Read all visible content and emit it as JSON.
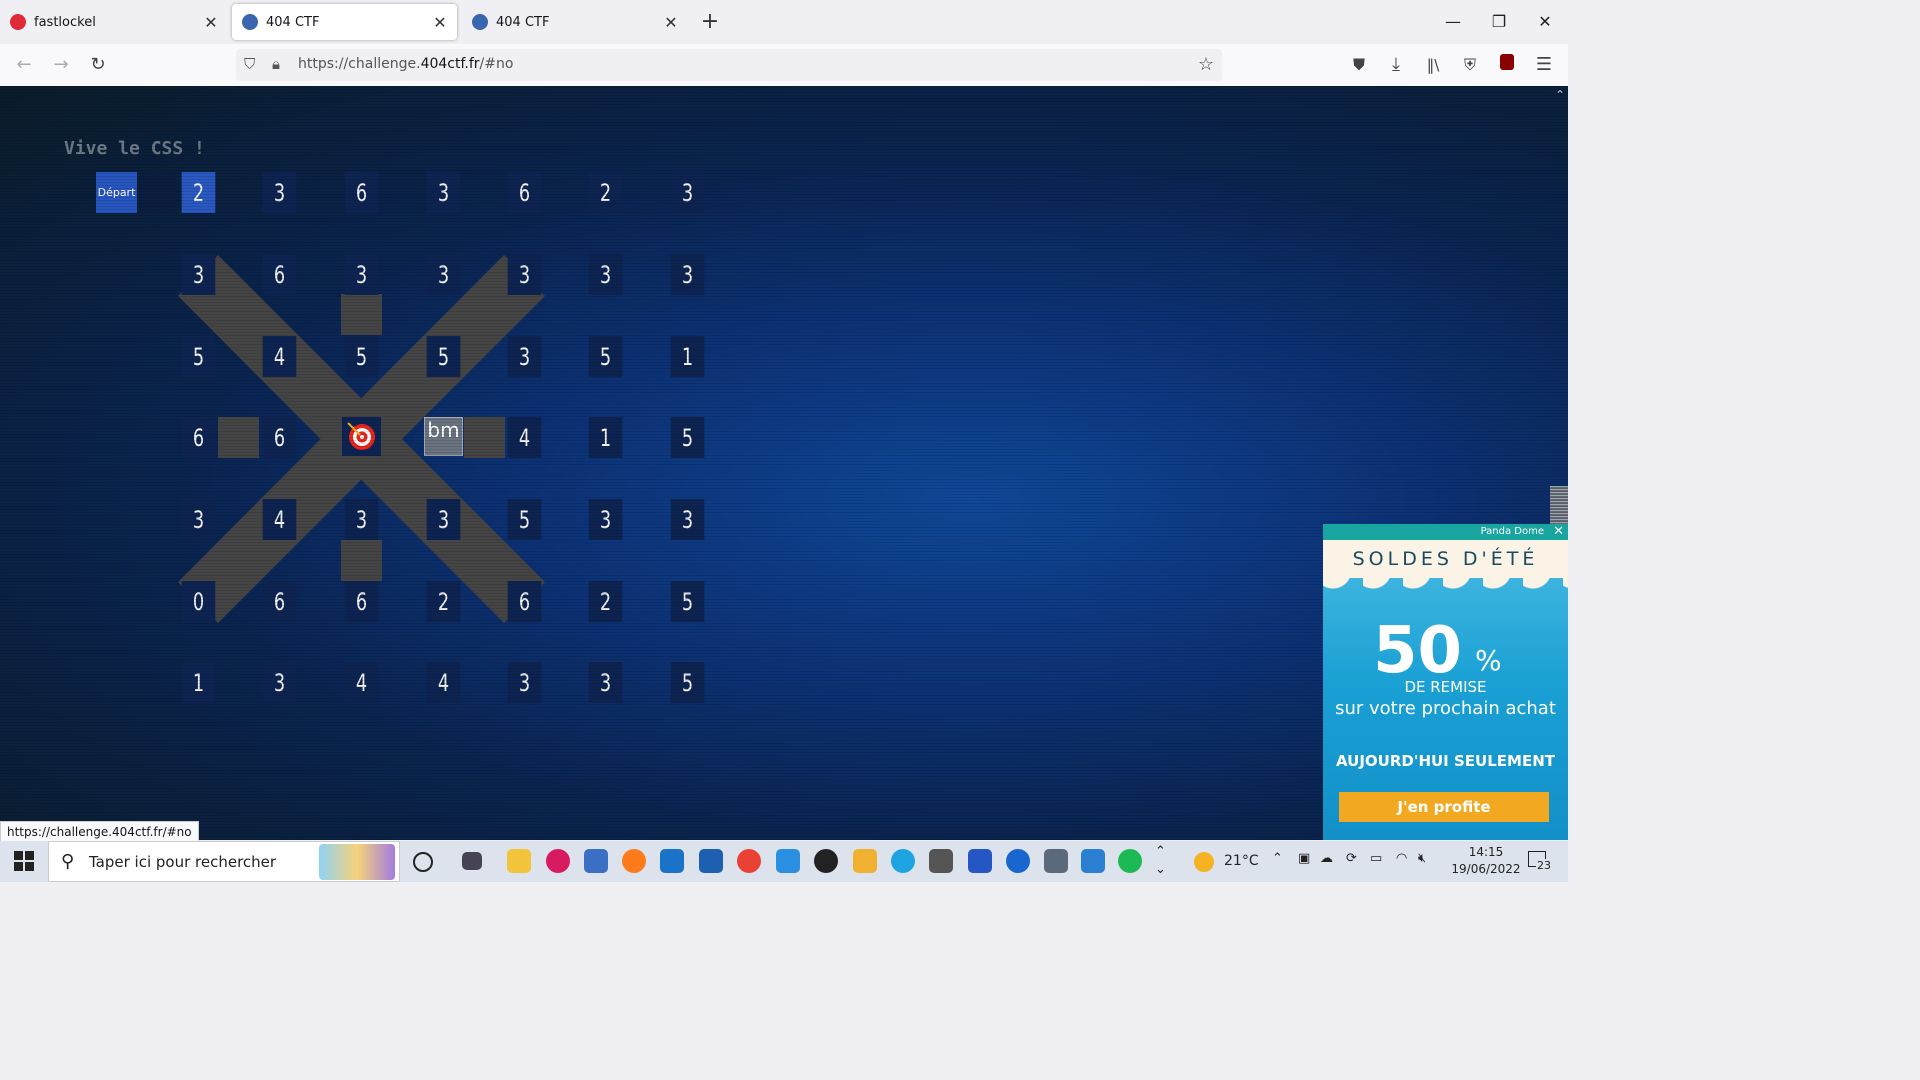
{
  "browser": {
    "tabs": [
      {
        "title": "fastlockel",
        "favicon_color": "#e02a3a"
      },
      {
        "title": "404 CTF",
        "favicon_color": "#3a66b0",
        "active": true
      },
      {
        "title": "404 CTF",
        "favicon_color": "#3a66b0"
      }
    ],
    "new_tab": "+",
    "url_scheme": "https://challenge.",
    "url_domain": "404ctf.fr",
    "url_path": "/#no",
    "status_url": "https://challenge.404ctf.fr/#no",
    "window": {
      "minimize": "—",
      "restore": "❐",
      "close": "✕"
    }
  },
  "page": {
    "heading": "Vive le CSS !",
    "start_label": "Départ",
    "grid_row0": [
      "2",
      "3",
      "6",
      "3",
      "6",
      "2",
      "3"
    ],
    "rows": [
      [
        "3",
        "6",
        "3",
        "3",
        "3",
        "3",
        "3"
      ],
      [
        "5",
        "4",
        "5",
        "5",
        "3",
        "5",
        "1"
      ],
      [
        "6",
        "",
        "6",
        "",
        "",
        "4",
        "1",
        "5"
      ],
      [
        "3",
        "4",
        "3",
        "3",
        "5",
        "3",
        "3"
      ],
      [
        "0",
        "6",
        "6",
        "2",
        "6",
        "2",
        "5"
      ],
      [
        "1",
        "3",
        "4",
        "4",
        "3",
        "3",
        "5"
      ]
    ],
    "bm_label": "bm",
    "colors": {
      "cell": "#0d2452",
      "highlight": "#2a59c2",
      "start": "#2856c0",
      "cross": "#454545"
    }
  },
  "ad": {
    "brand": "Panda Dome",
    "headline": "SOLDES D'ÉTÉ",
    "percent": "50",
    "percent_sign": "%",
    "remise": "DE REMISE",
    "subline": "sur votre prochain achat",
    "today": "AUJOURD'HUI SEULEMENT",
    "cta": "J'en profite"
  },
  "taskbar": {
    "search_placeholder": "Taper ici pour rechercher",
    "weather": "21°C",
    "time": "14:15",
    "date": "19/06/2022",
    "notifications": "23"
  }
}
